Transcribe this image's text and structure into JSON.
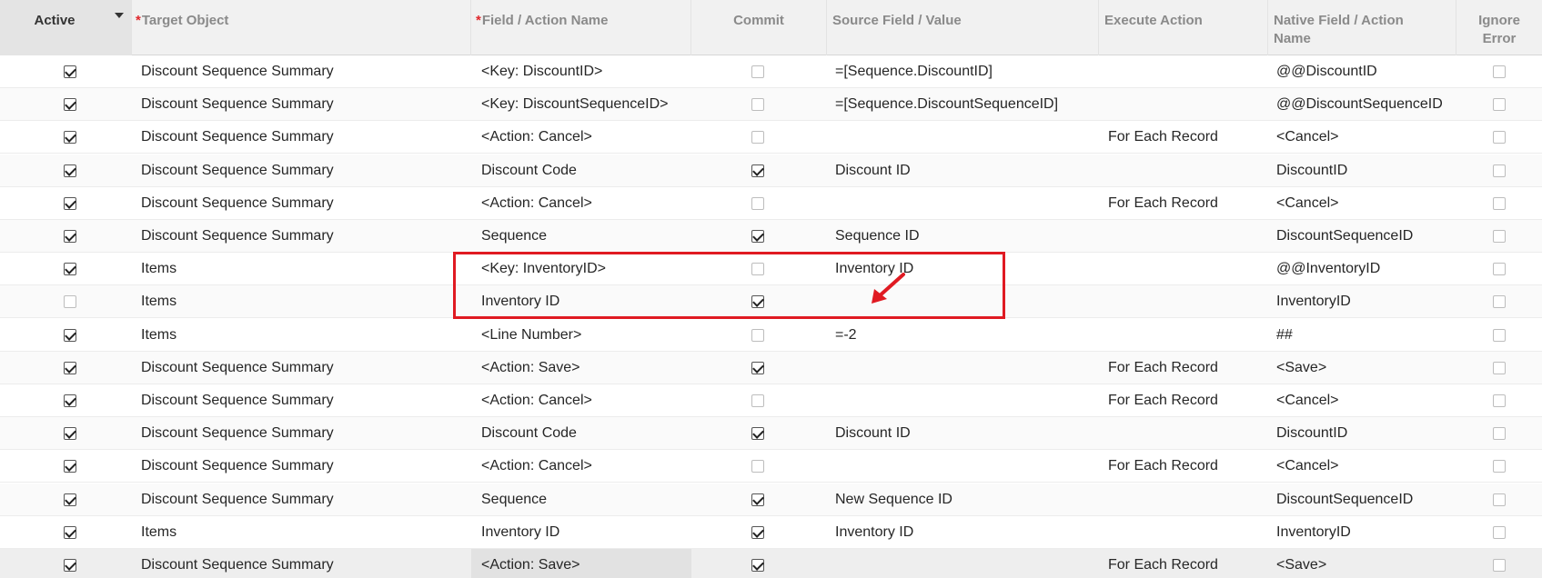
{
  "columns": {
    "active": "Active",
    "target_object": "Target Object",
    "field_action": "Field / Action Name",
    "commit": "Commit",
    "source_field": "Source Field / Value",
    "execute_action": "Execute Action",
    "native_field": "Native Field / Action Name",
    "ignore_error": "Ignore Error"
  },
  "required_marker": "*",
  "rows": [
    {
      "active": true,
      "target": "Discount Sequence Summary",
      "field": "<Key: DiscountID>",
      "commit": false,
      "source": "=[Sequence.DiscountID]",
      "execute": "",
      "native": "@@DiscountID",
      "ignore": false
    },
    {
      "active": true,
      "target": "Discount Sequence Summary",
      "field": "<Key: DiscountSequenceID>",
      "commit": false,
      "source": "=[Sequence.DiscountSequenceID]",
      "execute": "",
      "native": "@@DiscountSequenceID",
      "ignore": false
    },
    {
      "active": true,
      "target": "Discount Sequence Summary",
      "field": "<Action: Cancel>",
      "commit": false,
      "source": "",
      "execute": "For Each Record",
      "native": "<Cancel>",
      "ignore": false
    },
    {
      "active": true,
      "target": "Discount Sequence Summary",
      "field": "Discount Code",
      "commit": true,
      "source": "Discount ID",
      "execute": "",
      "native": "DiscountID",
      "ignore": false
    },
    {
      "active": true,
      "target": "Discount Sequence Summary",
      "field": "<Action: Cancel>",
      "commit": false,
      "source": "",
      "execute": "For Each Record",
      "native": "<Cancel>",
      "ignore": false
    },
    {
      "active": true,
      "target": "Discount Sequence Summary",
      "field": "Sequence",
      "commit": true,
      "source": "Sequence ID",
      "execute": "",
      "native": "DiscountSequenceID",
      "ignore": false
    },
    {
      "active": true,
      "target": "Items",
      "field": "<Key: InventoryID>",
      "commit": false,
      "source": "Inventory ID",
      "execute": "",
      "native": "@@InventoryID",
      "ignore": false
    },
    {
      "active": false,
      "target": "Items",
      "field": "Inventory ID",
      "commit": true,
      "source": "",
      "execute": "",
      "native": "InventoryID",
      "ignore": false
    },
    {
      "active": true,
      "target": "Items",
      "field": "<Line Number>",
      "commit": false,
      "source": "=-2",
      "execute": "",
      "native": "##",
      "ignore": false
    },
    {
      "active": true,
      "target": "Discount Sequence Summary",
      "field": "<Action: Save>",
      "commit": true,
      "source": "",
      "execute": "For Each Record",
      "native": "<Save>",
      "ignore": false
    },
    {
      "active": true,
      "target": "Discount Sequence Summary",
      "field": "<Action: Cancel>",
      "commit": false,
      "source": "",
      "execute": "For Each Record",
      "native": "<Cancel>",
      "ignore": false
    },
    {
      "active": true,
      "target": "Discount Sequence Summary",
      "field": "Discount Code",
      "commit": true,
      "source": "Discount ID",
      "execute": "",
      "native": "DiscountID",
      "ignore": false
    },
    {
      "active": true,
      "target": "Discount Sequence Summary",
      "field": "<Action: Cancel>",
      "commit": false,
      "source": "",
      "execute": "For Each Record",
      "native": "<Cancel>",
      "ignore": false
    },
    {
      "active": true,
      "target": "Discount Sequence Summary",
      "field": "Sequence",
      "commit": true,
      "source": "New Sequence ID",
      "execute": "",
      "native": "DiscountSequenceID",
      "ignore": false
    },
    {
      "active": true,
      "target": "Items",
      "field": "Inventory ID",
      "commit": true,
      "source": "Inventory ID",
      "execute": "",
      "native": "InventoryID",
      "ignore": false
    },
    {
      "active": true,
      "target": "Discount Sequence Summary",
      "field": "<Action: Save>",
      "commit": true,
      "source": "",
      "execute": "For Each Record",
      "native": "<Save>",
      "ignore": false
    }
  ],
  "selected_row": 15,
  "highlight_color": "#e01a22"
}
